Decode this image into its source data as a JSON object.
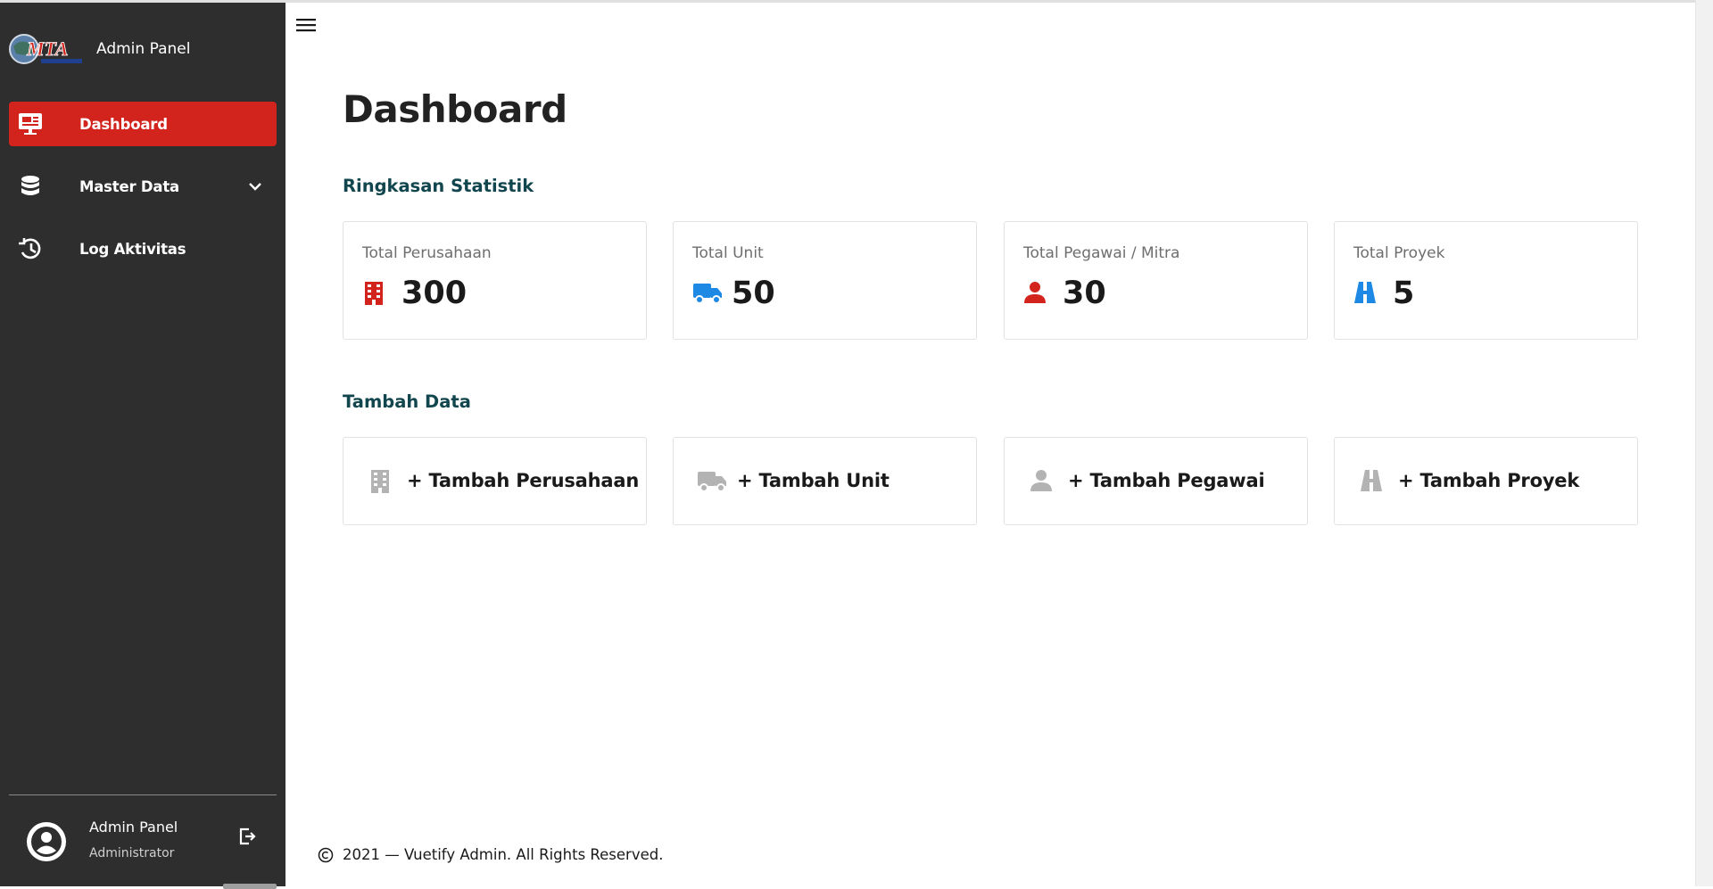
{
  "sidebar": {
    "brand_title": "Admin Panel",
    "logo_text": "MTA",
    "items": [
      {
        "label": "Dashboard",
        "icon": "monitor-icon",
        "active": true
      },
      {
        "label": "Master Data",
        "icon": "database-icon",
        "active": false
      },
      {
        "label": "Log Aktivitas",
        "icon": "history-icon",
        "active": false
      }
    ],
    "user": {
      "name": "Admin Panel",
      "role": "Administrator"
    }
  },
  "main": {
    "title": "Dashboard",
    "stats_title": "Ringkasan Statistik",
    "stats": [
      {
        "label": "Total Perusahaan",
        "value": "300",
        "icon": "building-icon",
        "color": "#d2231c"
      },
      {
        "label": "Total Unit",
        "value": "50",
        "icon": "truck-icon",
        "color": "#1e88e5"
      },
      {
        "label": "Total Pegawai / Mitra",
        "value": "30",
        "icon": "person-icon",
        "color": "#d2231c"
      },
      {
        "label": "Total Proyek",
        "value": "5",
        "icon": "road-icon",
        "color": "#1e88e5"
      }
    ],
    "add_title": "Tambah Data",
    "add_buttons": [
      {
        "label": "+ Tambah Perusahaan",
        "icon": "building-icon"
      },
      {
        "label": "+ Tambah Unit",
        "icon": "truck-icon"
      },
      {
        "label": "+ Tambah Pegawai",
        "icon": "person-icon"
      },
      {
        "label": "+ Tambah Proyek",
        "icon": "road-icon"
      }
    ],
    "footer": "2021 — Vuetify Admin. All Rights Reserved."
  },
  "colors": {
    "sidebar_bg": "#2e2e2e",
    "active": "#d2231c",
    "section_title": "#12464e",
    "icon_gray": "#b3b3b3"
  }
}
